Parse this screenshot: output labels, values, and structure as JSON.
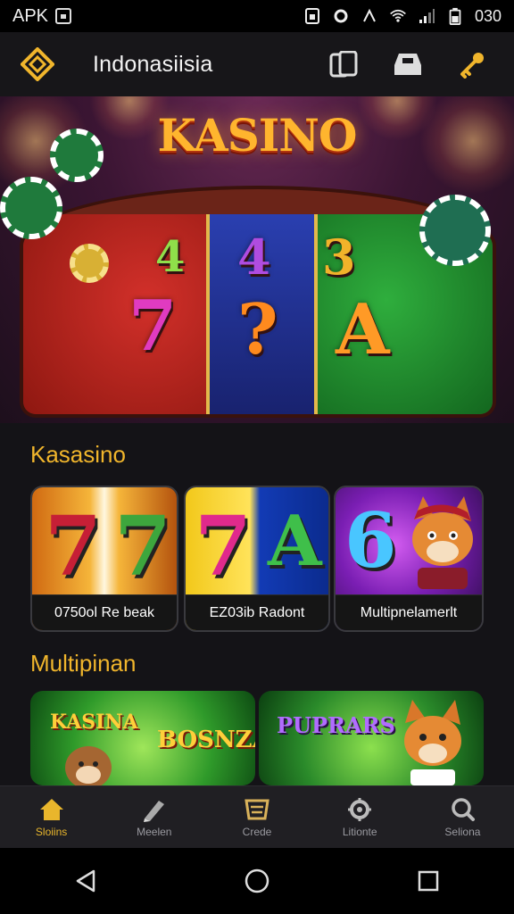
{
  "status_bar": {
    "app_label": "APK",
    "time": "030"
  },
  "header": {
    "title": "Indonasiisia"
  },
  "hero": {
    "title": "KASINO",
    "reels": [
      "4",
      "4",
      "3",
      "7",
      "?",
      "A"
    ]
  },
  "sections": {
    "kasasino": {
      "title": "Kasasino",
      "tiles": [
        {
          "caption": "0750ol Re beak",
          "symbols": [
            "7",
            "7"
          ]
        },
        {
          "caption": "EZ03ib Radont",
          "symbols": [
            "7",
            "A"
          ]
        },
        {
          "caption": "Multipnelamerlt",
          "symbols": [
            "6"
          ]
        }
      ]
    },
    "multipinan": {
      "title": "Multipinan",
      "cards": [
        {
          "text_a": "KASINA",
          "text_b": "BOSNZA"
        },
        {
          "text_a": "PUPRARS"
        }
      ]
    }
  },
  "bottom_nav": [
    {
      "label": "Sloiins",
      "icon": "home-icon",
      "active": true
    },
    {
      "label": "Meelen",
      "icon": "pencil-icon",
      "active": false
    },
    {
      "label": "Crede",
      "icon": "basket-icon",
      "active": false
    },
    {
      "label": "Litionte",
      "icon": "gear-icon",
      "active": false
    },
    {
      "label": "Seliona",
      "icon": "search-icon",
      "active": false
    }
  ],
  "colors": {
    "accent": "#f0b52c",
    "background": "#141317",
    "nav_bg": "#201f23"
  }
}
